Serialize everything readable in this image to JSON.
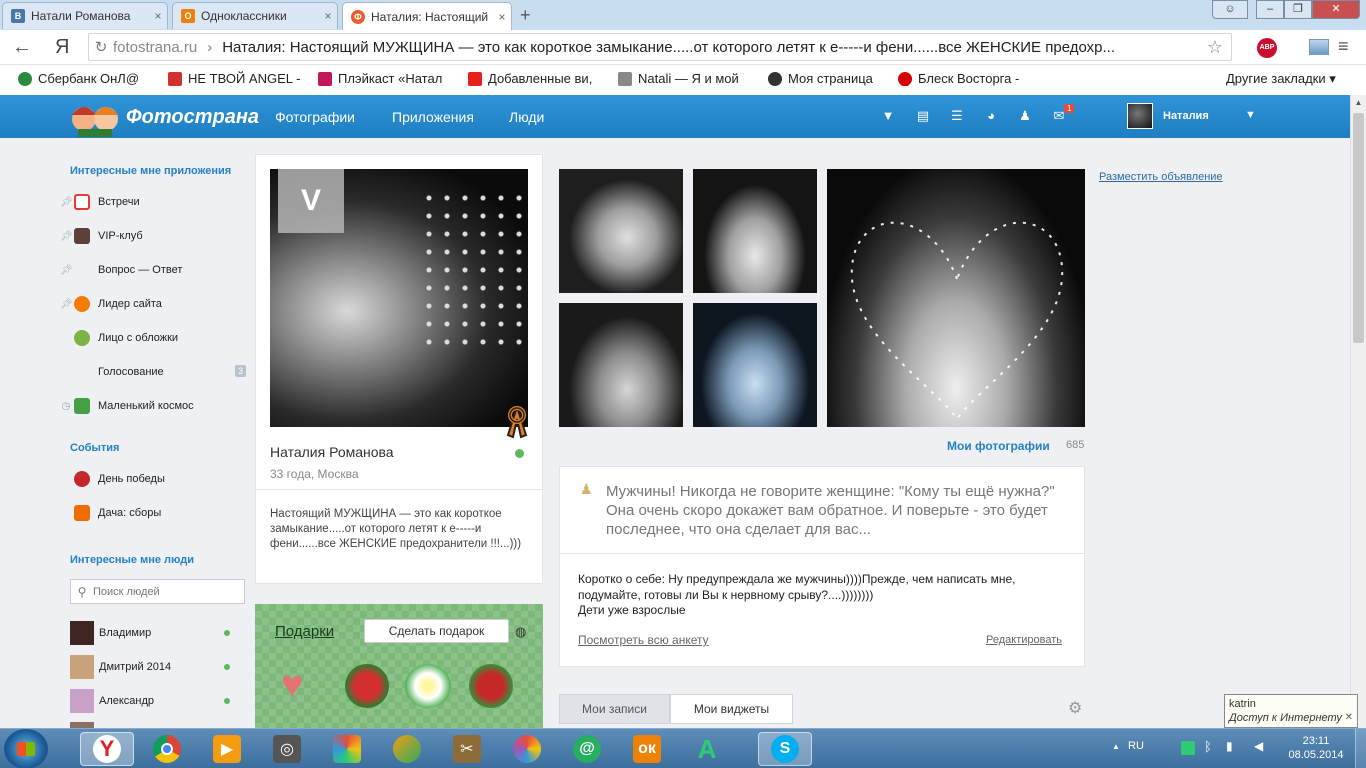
{
  "browser": {
    "tabs": [
      {
        "title": "Натали Романова",
        "icon": "vk-icon",
        "color": "#4a76a8"
      },
      {
        "title": "Одноклассники",
        "icon": "odnoklassniki-icon",
        "color": "#ee8208"
      },
      {
        "title": "Наталия: Настоящий",
        "icon": "fotostrana-icon",
        "color": "#e95e2b"
      }
    ],
    "new_tab": "+",
    "back": "←",
    "logo_letter": "Я",
    "url_domain": "fotostrana.ru",
    "url_title": "Наталия: Настоящий МУЖЩИНА — это как короткое замыкание.....от которого летят к е-----и фени......все ЖЕНСКИЕ предохр...",
    "star": "☆",
    "adblock": "ABP",
    "bookmarks": [
      {
        "label": "Сбербанк ОнЛ@",
        "color": "#2b8a3e"
      },
      {
        "label": "НЕ ТВОЙ ANGEL -",
        "color": "#d32f2f"
      },
      {
        "label": "Плэйкаст «Натал",
        "color": "#c2185b"
      },
      {
        "label": "Добавленные ви,",
        "color": "#e62117"
      },
      {
        "label": "Natali — Я и мой",
        "color": "#666666"
      },
      {
        "label": "Моя страница",
        "color": "#333333"
      },
      {
        "label": "Блеск Восторга -",
        "color": "#d50000"
      }
    ],
    "other_bookmarks": "Другие закладки ▾"
  },
  "site": {
    "name": "Фотострана",
    "nav": [
      "Фотографии",
      "Приложения",
      "Люди"
    ],
    "messages_badge": "1",
    "user_name": "Наталия"
  },
  "sidebar": {
    "apps_heading": "Интересные мне приложения",
    "apps": [
      {
        "label": "Встречи",
        "color": "#e53935",
        "pinned": true
      },
      {
        "label": "VIP-клуб",
        "color": "#5d4037",
        "pinned": true
      },
      {
        "label": "Вопрос — Ответ",
        "color": "",
        "pinned": true
      },
      {
        "label": "Лидер сайта",
        "color": "#f57c00",
        "pinned": true
      },
      {
        "label": "Лицо с обложки",
        "color": "#7cb342",
        "pinned": false
      },
      {
        "label": "Голосование",
        "color": "",
        "pinned": false,
        "badge": "3"
      },
      {
        "label": "Маленький космос",
        "color": "#43a047",
        "pinned": false
      }
    ],
    "events_heading": "События",
    "events": [
      {
        "label": "День победы",
        "color": "#c62828"
      },
      {
        "label": "Дача: сборы",
        "color": "#ef6c00"
      }
    ],
    "people_heading": "Интересные мне люди",
    "search_placeholder": "Поиск людей",
    "people": [
      {
        "name": "Владимир",
        "color": "#3e2723"
      },
      {
        "name": "Дмитрий 2014",
        "color": "#c8a27a"
      },
      {
        "name": "Александр",
        "color": "#c9a0c8"
      }
    ]
  },
  "profile": {
    "name": "Наталия Романова",
    "meta": "33 года, Москва",
    "status": "Настоящий МУЖЩИНА — это как короткое замыкание.....от которого летят к е-----и фени......все ЖЕНСКИЕ предохранители !!!...)))"
  },
  "gifts": {
    "title": "Подарки",
    "button": "Сделать подарок"
  },
  "photos": {
    "link": "Мои фотографии",
    "count": "685"
  },
  "quote": "Мужчины! Никогда не говорите женщине: \"Кому ты ещё нужна?\" Она очень скоро докажет вам обратное. И поверьте - это будет последнее, что она сделает для вас...",
  "about": {
    "line1": "Коротко о себе: Ну предупреждала же мужчины))))Прежде, чем написать мне, подумайте, готовы ли Вы к нервному срыву?....))))))))",
    "line2": "Дети уже взрослые",
    "view_all": "Посмотреть всю анкету",
    "edit": "Редактировать"
  },
  "tabs": [
    "Мои записи",
    "Мои виджеты"
  ],
  "ad_link": "Разместить объявление",
  "tooltip": {
    "user": "katrin",
    "status": "Доступ к Интернету"
  },
  "taskbar": {
    "lang": "RU",
    "time": "23:11",
    "date": "08.05.2014"
  }
}
